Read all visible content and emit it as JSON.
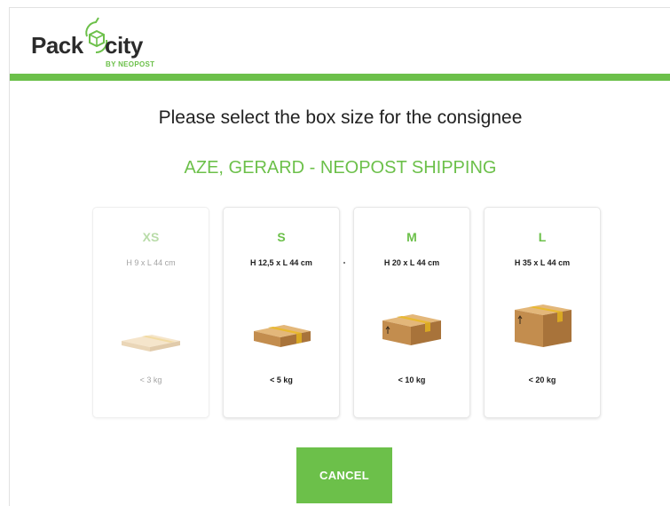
{
  "brand": {
    "name_part1": "Pack",
    "name_part2": "city",
    "tagline": "BY NEOPOST",
    "accent_color": "#6cc04a"
  },
  "prompt": {
    "title": "Please select the box size for the consignee",
    "consignee": "AZE, GERARD - NEOPOST SHIPPING"
  },
  "boxes": [
    {
      "size": "XS",
      "dimensions": "H 9 x L 44 cm",
      "weight": "< 3 kg",
      "enabled": false,
      "icon": "flat-box-icon"
    },
    {
      "size": "S",
      "dimensions": "H 12,5 x L 44 cm",
      "weight": "< 5 kg",
      "enabled": true,
      "icon": "small-box-icon"
    },
    {
      "size": "M",
      "dimensions": "H 20 x L 44 cm",
      "weight": "< 10 kg",
      "enabled": true,
      "icon": "medium-box-icon"
    },
    {
      "size": "L",
      "dimensions": "H 35 x L 44 cm",
      "weight": "< 20 kg",
      "enabled": true,
      "icon": "large-box-icon"
    }
  ],
  "actions": {
    "cancel_label": "CANCEL"
  }
}
